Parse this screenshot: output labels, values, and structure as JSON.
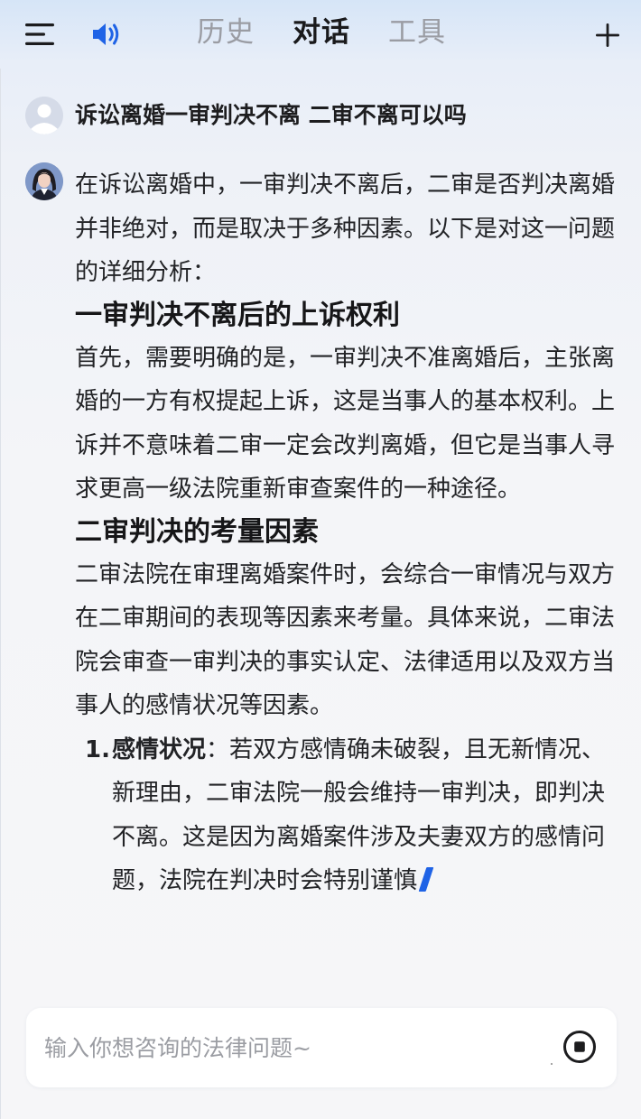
{
  "nav": {
    "tabs": [
      {
        "label": "历史",
        "active": false
      },
      {
        "label": "对话",
        "active": true
      },
      {
        "label": "工具",
        "active": false
      }
    ],
    "icons": [
      "menu-icon",
      "speaker-icon",
      "plus-icon"
    ]
  },
  "conversation": {
    "user_question": "诉讼离婚一审判决不离 二审不离可以吗",
    "answer": {
      "intro": "在诉讼离婚中，一审判决不离后，二审是否判决离婚并非绝对，而是取决于多种因素。以下是对这一问题的详细分析：",
      "sections": [
        {
          "heading": "一审判决不离后的上诉权利",
          "body": "首先，需要明确的是，一审判决不准离婚后，主张离婚的一方有权提起上诉，这是当事人的基本权利。上诉并不意味着二审一定会改判离婚，但它是当事人寻求更高一级法院重新审查案件的一种途径。"
        },
        {
          "heading": "二审判决的考量因素",
          "body": "二审法院在审理离婚案件时，会综合一审情况与双方在二审期间的表现等因素来考量。具体来说，二审法院会审查一审判决的事实认定、法律适用以及双方当事人的感情状况等因素。",
          "list": [
            {
              "number": "1.",
              "term": "感情状况",
              "text": "：若双方感情确未破裂，且无新情况、新理由，二审法院一般会维持一审判决，即判决不离。这是因为离婚案件涉及夫妻双方的感情问题，法院在判决时会特别谨慎"
            }
          ]
        }
      ],
      "streaming": true
    }
  },
  "input": {
    "placeholder": "输入你想咨询的法律问题~",
    "value": ""
  },
  "colors": {
    "accent": "#1f63e6",
    "active_tab": "#1a1a1c",
    "inactive_tab": "#9a9ca3",
    "header_gradient_top": "#d6e5f7"
  }
}
